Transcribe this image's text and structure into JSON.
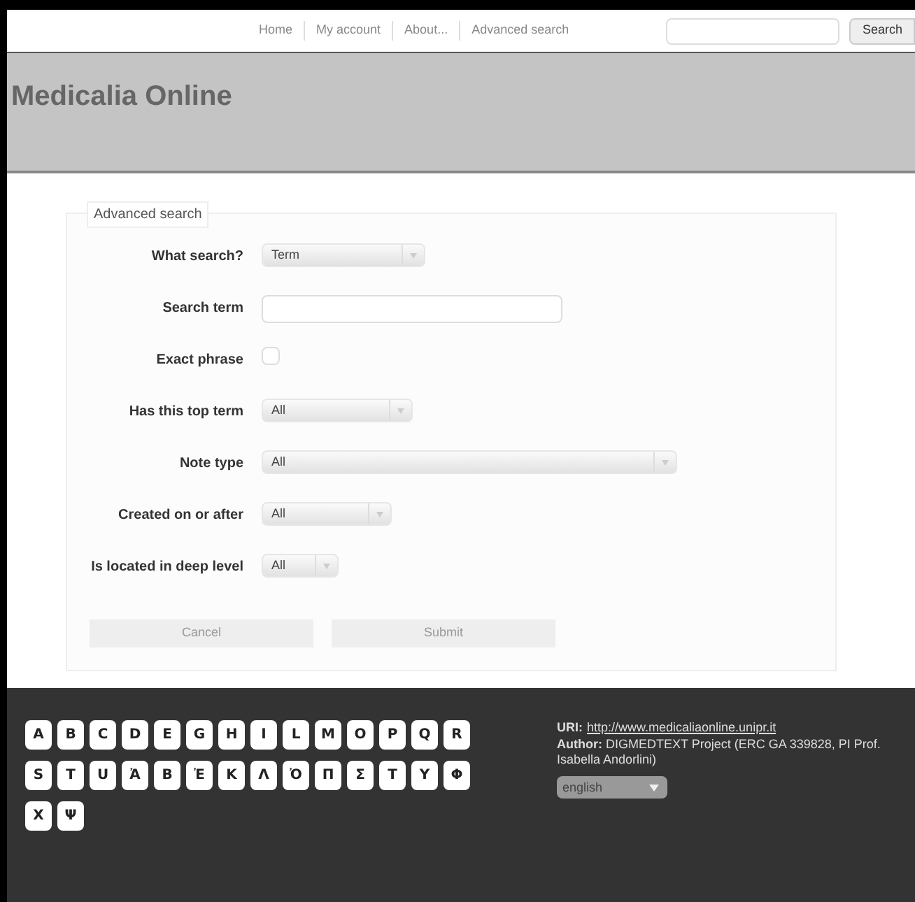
{
  "top_nav": {
    "links": [
      "Home",
      "My account",
      "About...",
      "Advanced search"
    ],
    "search_button": "Search"
  },
  "header": {
    "title": "Medicalia Online"
  },
  "form": {
    "legend": "Advanced search",
    "fields": [
      {
        "kind": "select",
        "label": "What search?",
        "value": "Term"
      },
      {
        "kind": "text",
        "label": "Search term"
      },
      {
        "kind": "checkbox",
        "label": "Exact phrase",
        "checked": false
      },
      {
        "kind": "select",
        "label": "Has this top term",
        "value": "All"
      },
      {
        "kind": "select",
        "label": "Note type",
        "value": "All"
      },
      {
        "kind": "select",
        "label": "Created on or after",
        "value": "All"
      },
      {
        "kind": "select",
        "label": "Is located in deep level",
        "value": "All"
      }
    ],
    "buttons": [
      "Cancel",
      "Submit"
    ]
  },
  "footer": {
    "letters": [
      "A",
      "B",
      "C",
      "D",
      "E",
      "G",
      "H",
      "I",
      "L",
      "M",
      "O",
      "P",
      "Q",
      "R",
      "S",
      "T",
      "U",
      "Ἀ",
      "Β",
      "Ἐ",
      "Κ",
      "Λ",
      "Ὀ",
      "Π",
      "Σ",
      "Τ",
      "Υ",
      "Φ",
      "Χ",
      "Ψ"
    ],
    "uri_label": "URI:",
    "uri": "http://www.medicaliaonline.unipr.it",
    "author_label": "Author:",
    "author": "DIGMEDTEXT Project (ERC GA 339828, PI Prof. Isabella Andorlini)",
    "language": "english"
  }
}
